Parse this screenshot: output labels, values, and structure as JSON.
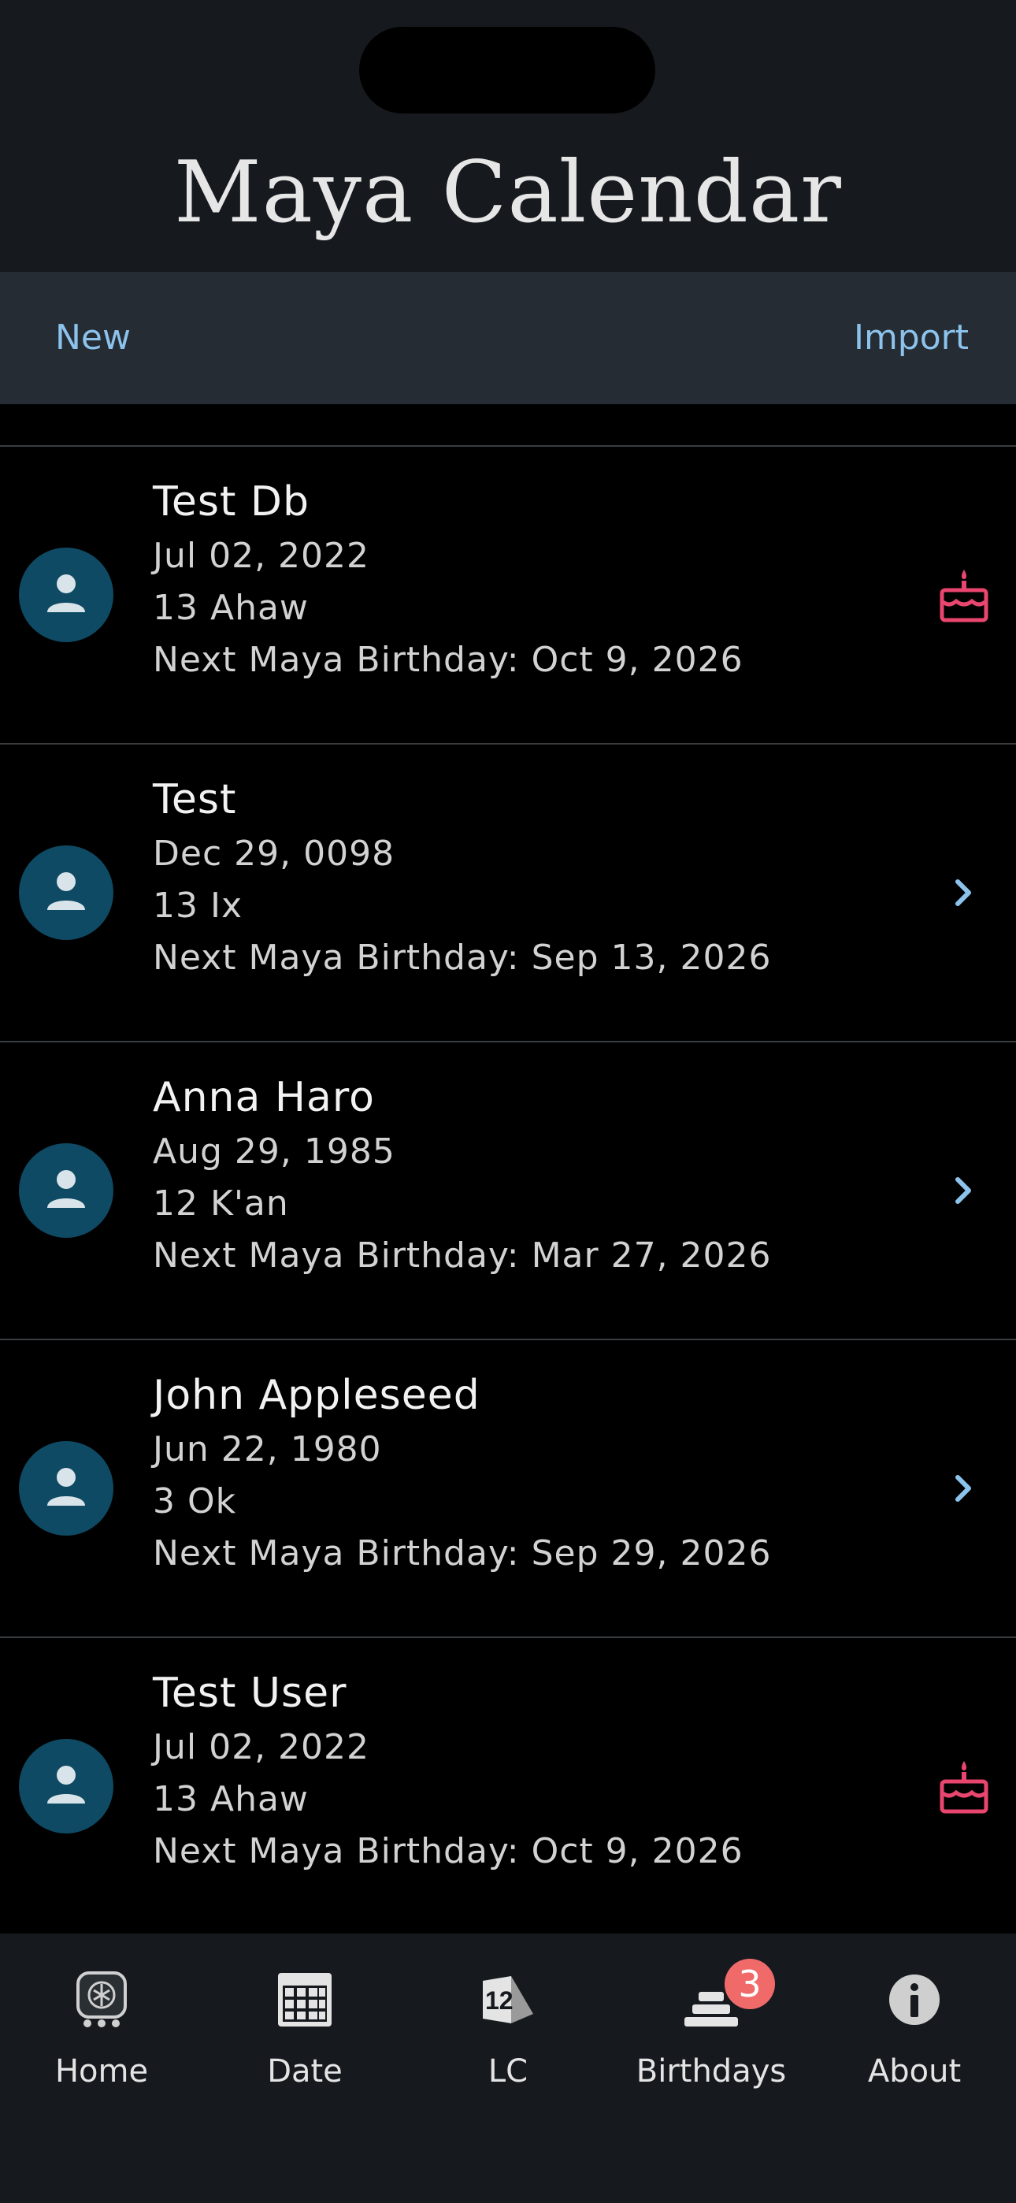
{
  "app": {
    "title": "Maya Calendar"
  },
  "toolbar": {
    "new_label": "New",
    "import_label": "Import"
  },
  "birthdays": [
    {
      "name": "Test Db",
      "date": "Jul 02, 2022",
      "maya_date": "13 Ahaw",
      "next": "Next Maya Birthday: Oct 9, 2026",
      "trailing_icon": "cake-icon"
    },
    {
      "name": "Test",
      "date": "Dec 29, 0098",
      "maya_date": "13 Ix",
      "next": "Next Maya Birthday: Sep 13, 2026",
      "trailing_icon": "chevron-right-icon"
    },
    {
      "name": "Anna Haro",
      "date": "Aug 29, 1985",
      "maya_date": "12 K'an",
      "next": "Next Maya Birthday: Mar 27, 2026",
      "trailing_icon": "chevron-right-icon"
    },
    {
      "name": "John Appleseed",
      "date": "Jun 22, 1980",
      "maya_date": "3 Ok",
      "next": "Next Maya Birthday: Sep 29, 2026",
      "trailing_icon": "chevron-right-icon"
    },
    {
      "name": "Test User",
      "date": "Jul 02, 2022",
      "maya_date": "13 Ahaw",
      "next": "Next Maya Birthday: Oct 9, 2026",
      "trailing_icon": "cake-icon"
    }
  ],
  "tabs": [
    {
      "label": "Home",
      "icon": "maya-glyph-icon"
    },
    {
      "label": "Date",
      "icon": "calendar-grid-icon"
    },
    {
      "label": "LC",
      "icon": "long-count-icon"
    },
    {
      "label": "Birthdays",
      "icon": "birthday-cake-icon",
      "badge": "3"
    },
    {
      "label": "About",
      "icon": "info-icon"
    }
  ],
  "colors": {
    "accent": "#8cc3ec",
    "cake": "#e8466e",
    "avatar_bg": "#0e4a63",
    "avatar_fg": "#d8e4ea",
    "badge": "#f06a6a"
  }
}
